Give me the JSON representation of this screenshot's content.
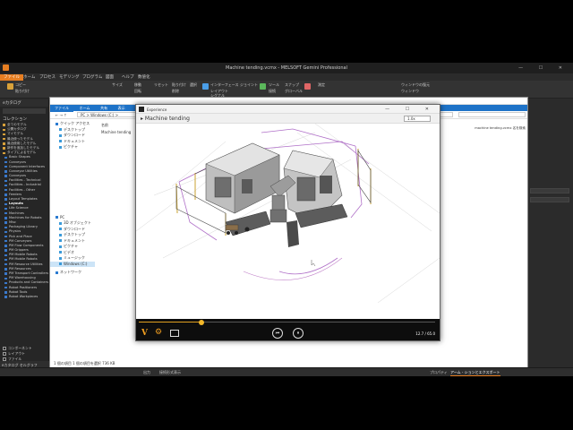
{
  "window": {
    "title": "Machine tending.vcmx - MELSOFT Gemini Professional",
    "controls": "—  ☐  ✕"
  },
  "menu_tabs": [
    "ファイル",
    "ホーム",
    "プロセス",
    "モデリング",
    "プログラム",
    "図面",
    "ヘルプ",
    "数値化"
  ],
  "ribbon": {
    "labels": [
      "コピー",
      "貼り付け",
      "サイズ",
      "移動",
      "回転",
      "リセット",
      "貼り付け",
      "削除",
      "選択",
      "インターフェース",
      "レイアウト",
      "シグナル",
      "ジョイント",
      "ツール",
      "接続",
      "スナップ",
      "グローバル",
      "測定",
      "ウィンドウの復元",
      "ウィンドウ"
    ]
  },
  "left_panel": {
    "header": "eカタログ",
    "collections_title": "コレクション",
    "categories": [
      "全てのモデル",
      "公開カタログ",
      "マイモデル",
      "最近使ったモデル",
      "最近使用したモデル",
      "新作を追加したモデル",
      "タイプによるモデル"
    ],
    "items": [
      "Basic Shapes",
      "Conveyors",
      "Component Interfaces",
      "Conveyor Utilities",
      "Conveyors",
      "Facilities - Technical",
      "Facilities - Industrial",
      "Facilities - Other",
      "Feeders",
      "Layout Templates",
      "Layouts",
      "Life Science",
      "Machines",
      "Machines for Robots",
      "Misc",
      "Packaging Library",
      "Physics",
      "Pick and Place",
      "PM Conveyors",
      "PM Flow Components",
      "PM Grippers",
      "PM Mobile Robots",
      "PM Mobile Robots",
      "PM Resource Utilities",
      "PM Resources",
      "PM Transport Controllers",
      "PM Warehousing",
      "Products and Containers",
      "Robot Positioners",
      "Robot Tools",
      "Robot Workpieces"
    ],
    "bold_item": "Layouts",
    "checks": [
      "コンポーネント",
      "レイアウト",
      "ファイル"
    ],
    "bottom_tabs": "eカタログ  セルグラフ"
  },
  "explorer": {
    "title": "",
    "ribbon_tabs": [
      "ファイル",
      "ホーム",
      "共有",
      "表示"
    ],
    "path": "PC  >  Windows (C:)  >",
    "search_hint": "",
    "nav": {
      "quick_access": "クイック アクセス",
      "quick_items": [
        "デスクトップ",
        "ダウンロード",
        "ドキュメント",
        "ピクチャ"
      ],
      "pc": "PC",
      "pc_items": [
        "3D オブジェクト",
        "ダウンロード",
        "デスクトップ",
        "ドキュメント",
        "ピクチャ",
        "ビデオ",
        "ミュージック",
        "Windows (C:)"
      ],
      "network": "ネットワーク"
    },
    "files_header": "名前",
    "file": "Machine tending",
    "status": "1 個の項目     1 個の項目を選択  736 KB",
    "right_hint": "machine tending.vcmx 名を検索"
  },
  "player": {
    "window_title": "Experience",
    "scene_name": "Machine tending",
    "speed": "1.0x",
    "time": "12.7 / 65.0",
    "progress": 0.21,
    "controls": {
      "rewind": "⏮",
      "pause": "⏸"
    }
  },
  "bottom_bar": {
    "items": [
      "出力",
      "接続形式表示",
      "プロパティ",
      "アーム - ションとエクスポート"
    ]
  }
}
